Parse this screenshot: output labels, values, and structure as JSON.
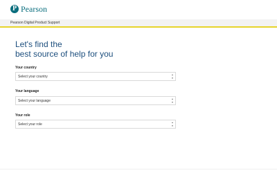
{
  "header": {
    "brand_name": "Pearson",
    "brand_mark": "P"
  },
  "subbar": {
    "title": "Pearson Digital Product Support"
  },
  "main": {
    "headline_line1": "Let's find the",
    "headline_line2": "best source of help for you"
  },
  "form": {
    "country": {
      "label": "Your country",
      "value": "Select your country"
    },
    "language": {
      "label": "Your language",
      "value": "Select your language"
    },
    "role": {
      "label": "Your role",
      "value": "Select your role"
    }
  },
  "icons": {
    "select_arrows": "up-down-arrows-icon"
  },
  "colors": {
    "brand": "#0b6e7e",
    "headline": "#1c4e7d",
    "accent_bar": "#e6d42a"
  }
}
